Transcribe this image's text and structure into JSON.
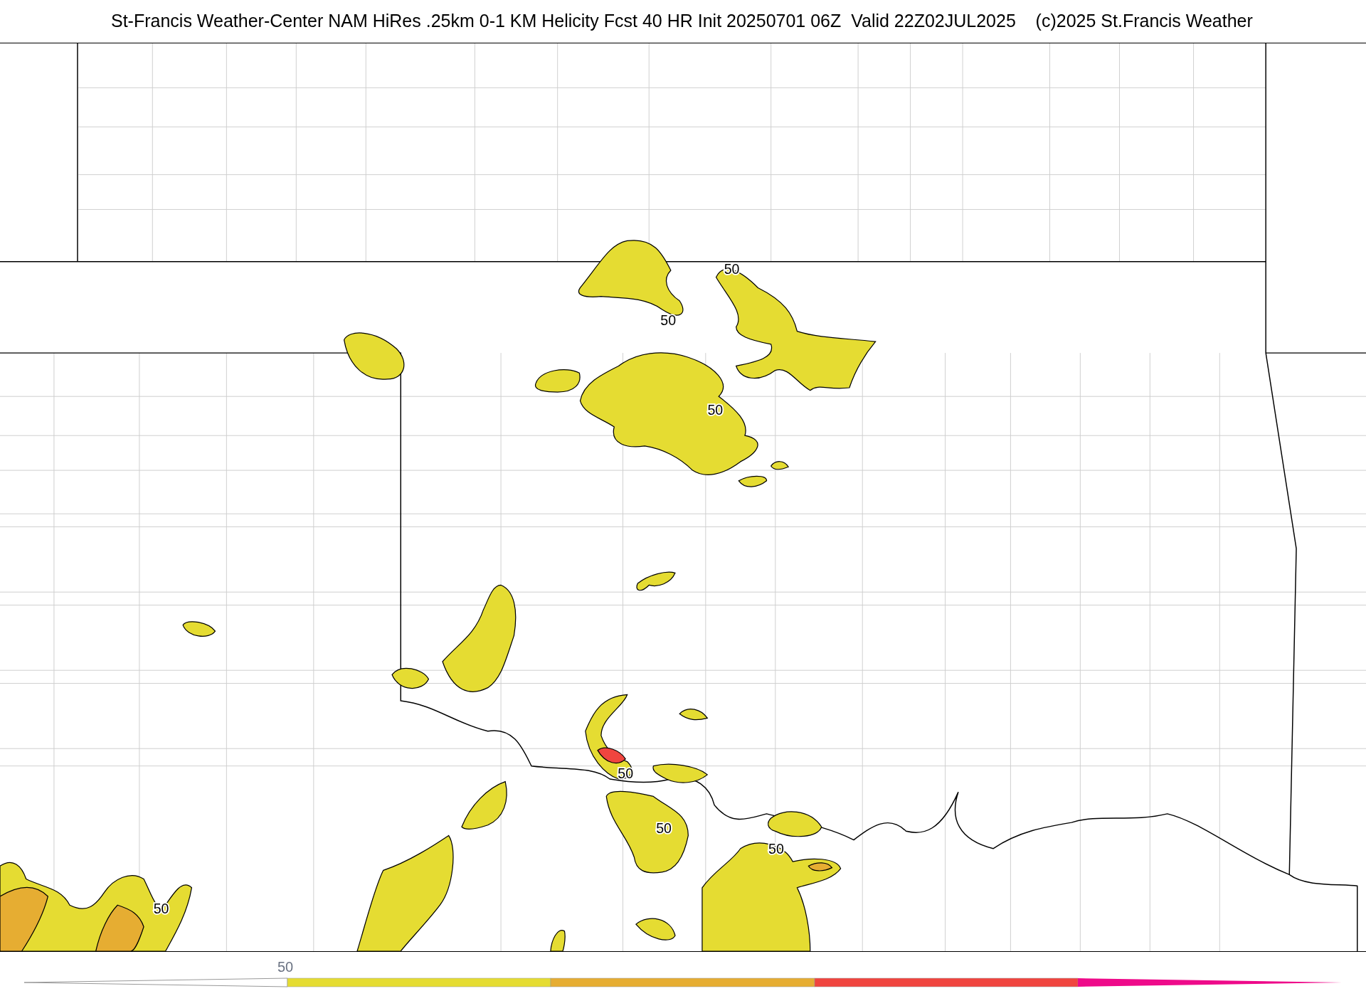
{
  "title": "St-Francis Weather-Center NAM HiRes .25km 0-1 KM Helicity Fcst 40 HR Init 20250701 06Z  Valid 22Z02JUL2025    (c)2025 St.Francis Weather",
  "map": {
    "contour_labels": [
      "50",
      "50",
      "50",
      "50",
      "50",
      "50",
      "50"
    ]
  },
  "colorbar": {
    "tick_label": "50",
    "segments": [
      {
        "color": "#ffffff"
      },
      {
        "color": "#e5dc32"
      },
      {
        "color": "#e6ad32"
      },
      {
        "color": "#f0453f"
      },
      {
        "color": "#ee0a8a"
      }
    ]
  }
}
